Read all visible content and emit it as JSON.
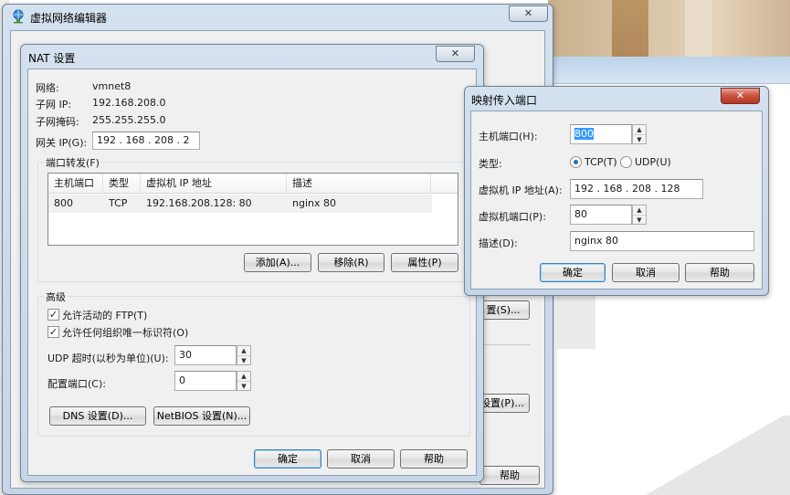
{
  "colors": {
    "titlebar": "#d4e1ef",
    "selection": "#3399ff",
    "close_red": "#c8503b"
  },
  "main_window": {
    "title": "虚拟网络编辑器",
    "icon": "network-globe-icon",
    "close_label": "✕",
    "bg_buttons": {
      "settings_s": "置(S)...",
      "settings_p": "设置(P)...",
      "help": "帮助"
    }
  },
  "nat": {
    "title": "NAT 设置",
    "close_label": "✕",
    "network_label": "网络:",
    "network_value": "vmnet8",
    "subnet_ip_label": "子网 IP:",
    "subnet_ip_value": "192.168.208.0",
    "subnet_mask_label": "子网掩码:",
    "subnet_mask_value": "255.255.255.0",
    "gateway_label": "网关 IP(G):",
    "gateway_value": "192 . 168 . 208 .  2",
    "port_forwarding": {
      "title": "端口转发(F)",
      "columns": [
        "主机端口",
        "类型",
        "虚拟机 IP 地址",
        "描述"
      ],
      "rows": [
        {
          "host_port": "800",
          "type": "TCP",
          "vm_ip": "192.168.208.128: 80",
          "desc": "nginx 80"
        }
      ],
      "add": "添加(A)...",
      "remove": "移除(R)",
      "properties": "属性(P)"
    },
    "advanced": {
      "title": "高级",
      "allow_ftp": "允许活动的 FTP(T)",
      "allow_ftp_checked": true,
      "allow_uuid": "允许任何组织唯一标识符(O)",
      "allow_uuid_checked": true,
      "udp_timeout_label": "UDP 超时(以秒为单位)(U):",
      "udp_timeout_value": "30",
      "config_port_label": "配置端口(C):",
      "config_port_value": "0",
      "dns": "DNS 设置(D)...",
      "netbios": "NetBIOS 设置(N)..."
    },
    "ok": "确定",
    "cancel": "取消",
    "help": "帮助"
  },
  "map": {
    "title": "映射传入端口",
    "close_label": "✕",
    "host_port_label": "主机端口(H):",
    "host_port_value": "800",
    "type_label": "类型:",
    "tcp_label": "TCP(T)",
    "udp_label": "UDP(U)",
    "selected_type": "TCP",
    "vm_ip_label": "虚拟机 IP 地址(A):",
    "vm_ip_value": "192 . 168 . 208 . 128",
    "vm_port_label": "虚拟机端口(P):",
    "vm_port_value": "80",
    "desc_label": "描述(D):",
    "desc_value": "nginx 80",
    "ok": "确定",
    "cancel": "取消",
    "help": "帮助"
  }
}
